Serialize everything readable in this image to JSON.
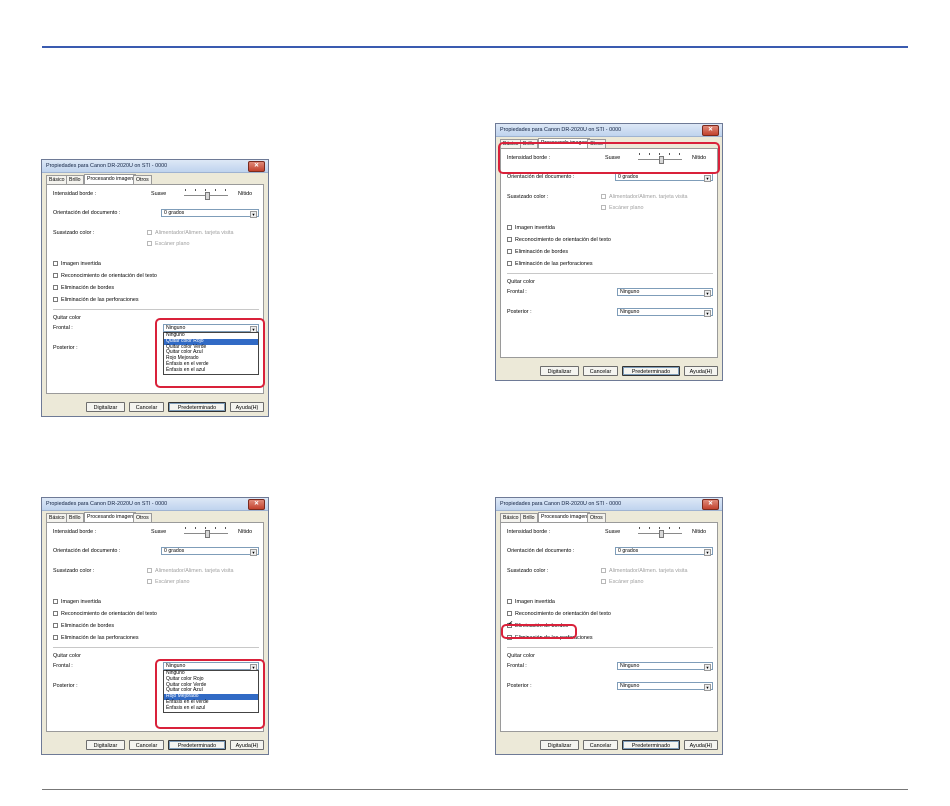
{
  "dialog": {
    "title": "Propiedades para Canon DR-2020U on STI - 0000",
    "close_label": "✕",
    "tabs": [
      "Básico",
      "Brillo",
      "Procesando imagen",
      "Otros"
    ],
    "edge_intensity": {
      "label": "Intensidad borde :",
      "soft": "Suave",
      "sharp": "Nítido"
    },
    "orientation": {
      "label": "Orientación del documento :",
      "value": "0 grados"
    },
    "color_smoothing": {
      "label": "Suavizado color :",
      "option1": "Alimentador/Alimen. tarjeta visita",
      "option2": "Escáner plano"
    },
    "checkboxes": [
      "Imagen invertida",
      "Reconocimiento de orientación del texto",
      "Eliminación de bordes",
      "Eliminación de las perforaciones"
    ],
    "remove_color": {
      "group_label": "Quitar color",
      "front_label": "Frontal :",
      "back_label": "Posterior :",
      "front_value": "Ninguno",
      "back_value": "Ninguno"
    },
    "dropdown_options": [
      "Ninguno",
      "Quitar color Rojo",
      "Quitar color Verde",
      "Quitar color Azul",
      "Rojo Mejorado",
      "Énfasis en el verde",
      "Énfasis en el azul"
    ],
    "buttons": {
      "scan": "Digitalizar",
      "cancel": "Cancelar",
      "default": "Predeterminado",
      "help": "Ayuda(H)"
    }
  },
  "variants": [
    {
      "name": "dropdown-red-selected",
      "dropdown_open": true,
      "selected_index": 1,
      "border_removal_checked": false
    },
    {
      "name": "edge-intensity-highlight",
      "dropdown_open": false,
      "selected_index": -1,
      "border_removal_checked": false
    },
    {
      "name": "dropdown-enhanced-red-selected",
      "dropdown_open": true,
      "selected_index": 4,
      "border_removal_checked": false
    },
    {
      "name": "border-removal-checked",
      "dropdown_open": false,
      "selected_index": -1,
      "border_removal_checked": true
    }
  ],
  "colors": {
    "accent_rule": "#3a5bb0",
    "highlight": "#d9213a",
    "selection": "#316ac5"
  }
}
